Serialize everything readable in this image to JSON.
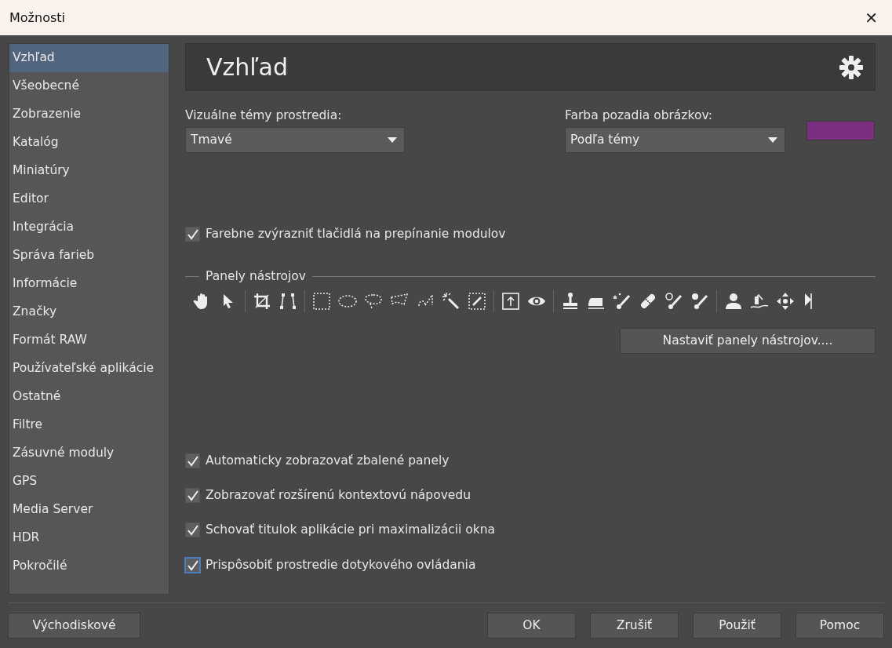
{
  "window": {
    "title": "Možnosti",
    "close": "✕"
  },
  "sidebar": {
    "items": [
      {
        "label": "Vzhľad",
        "selected": true
      },
      {
        "label": "Všeobecné",
        "selected": false
      },
      {
        "label": "Zobrazenie",
        "selected": false
      },
      {
        "label": "Katalóg",
        "selected": false
      },
      {
        "label": "Miniatúry",
        "selected": false
      },
      {
        "label": "Editor",
        "selected": false
      },
      {
        "label": "Integrácia",
        "selected": false
      },
      {
        "label": "Správa farieb",
        "selected": false
      },
      {
        "label": "Informácie",
        "selected": false
      },
      {
        "label": "Značky",
        "selected": false
      },
      {
        "label": "Formát RAW",
        "selected": false
      },
      {
        "label": "Používateľské aplikácie",
        "selected": false
      },
      {
        "label": "Ostatné",
        "selected": false
      },
      {
        "label": "Filtre",
        "selected": false
      },
      {
        "label": "Zásuvné moduly",
        "selected": false
      },
      {
        "label": "GPS",
        "selected": false
      },
      {
        "label": "Media Server",
        "selected": false
      },
      {
        "label": "HDR",
        "selected": false
      },
      {
        "label": "Pokročilé",
        "selected": false
      }
    ]
  },
  "header": {
    "title": "Vzhľad"
  },
  "theme": {
    "label": "Vizuálne témy prostredia:",
    "value": "Tmavé"
  },
  "background": {
    "label": "Farba pozadia obrázkov:",
    "value": "Podľa témy",
    "color": "#7b2d7f"
  },
  "highlight_option": {
    "label": "Farebne zvýrazniť tlačidlá na prepínanie modulov",
    "checked": true,
    "focused": false
  },
  "toolbars": {
    "title": "Panely nástrojov",
    "button": "Nastaviť panely nástrojov...."
  },
  "options": [
    {
      "label": "Automaticky zobrazovať zbalené panely",
      "checked": true,
      "focused": false
    },
    {
      "label": "Zobrazovať rozšírenú kontextovú nápovedu",
      "checked": true,
      "focused": false
    },
    {
      "label": "Schovať titulok aplikácie pri maximalizácii okna",
      "checked": true,
      "focused": false
    },
    {
      "label": "Prispôsobiť prostredie dotykového ovládania",
      "checked": true,
      "focused": true
    }
  ],
  "footer": {
    "left_button": "Východiskové",
    "buttons": [
      "OK",
      "Zrušiť",
      "Použiť",
      "Pomoc"
    ]
  }
}
